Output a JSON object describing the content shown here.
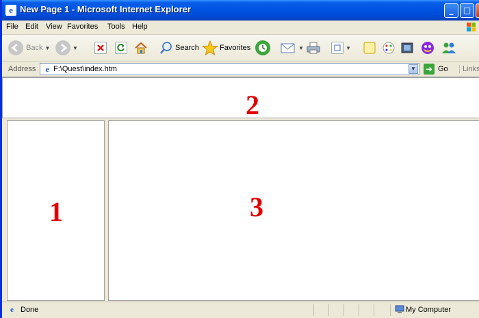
{
  "window": {
    "title": "New Page 1 - Microsoft Internet Explorer",
    "minimize": "_",
    "maximize": "□",
    "close": "✕"
  },
  "menu": [
    "File",
    "Edit",
    "View",
    "Favorites",
    "Tools",
    "Help"
  ],
  "toolbar": {
    "back_label": "Back",
    "search_label": "Search",
    "favorites_label": "Favorites"
  },
  "address": {
    "label": "Address",
    "value": "F:\\Quest\\index.htm",
    "go_label": "Go",
    "links_label": "Links"
  },
  "frames": {
    "top": "2",
    "left": "1",
    "main": "3"
  },
  "status": {
    "text": "Done",
    "zone": "My Computer"
  },
  "colors": {
    "title_bar": "#0054e3",
    "frame_number": "#e00000"
  }
}
